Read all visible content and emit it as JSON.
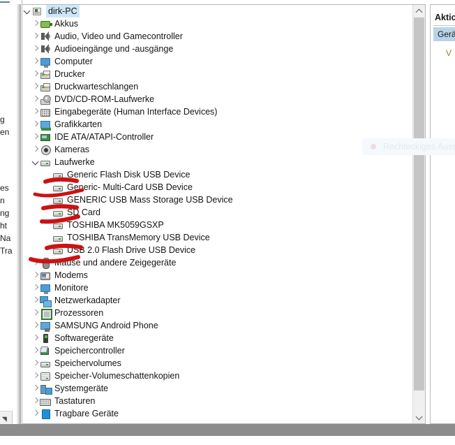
{
  "window": {
    "title_fragment": "Aktio",
    "bottom_bar_color": "#8c8c8c"
  },
  "left_background_window": {
    "text_fragments": [
      "g",
      "en",
      "es",
      "n",
      "ng",
      "ht",
      "Na",
      "Tra"
    ]
  },
  "tree": {
    "root": {
      "label": "dirk-PC",
      "icon": "computer-tower-icon",
      "expanded": true,
      "selected": true
    },
    "nodes": [
      {
        "label": "Akkus",
        "icon": "battery-icon",
        "level": 1,
        "expanded": false
      },
      {
        "label": "Audio, Video und Gamecontroller",
        "icon": "speaker-icon",
        "level": 1,
        "expanded": false
      },
      {
        "label": "Audioeingänge und -ausgänge",
        "icon": "speaker-icon",
        "level": 1,
        "expanded": false
      },
      {
        "label": "Computer",
        "icon": "monitor-icon",
        "level": 1,
        "expanded": false
      },
      {
        "label": "Drucker",
        "icon": "printer-icon",
        "level": 1,
        "expanded": false
      },
      {
        "label": "Druckwarteschlangen",
        "icon": "printer-icon",
        "level": 1,
        "expanded": false
      },
      {
        "label": "DVD/CD-ROM-Laufwerke",
        "icon": "dvd-drive-icon",
        "level": 1,
        "expanded": false
      },
      {
        "label": "Eingabegeräte (Human Interface Devices)",
        "icon": "hid-icon",
        "level": 1,
        "expanded": false
      },
      {
        "label": "Grafikkarten",
        "icon": "graphics-card-icon",
        "level": 1,
        "expanded": false
      },
      {
        "label": "IDE ATA/ATAPI-Controller",
        "icon": "ide-controller-icon",
        "level": 1,
        "expanded": false
      },
      {
        "label": "Kameras",
        "icon": "camera-icon",
        "level": 1,
        "expanded": false
      },
      {
        "label": "Laufwerke",
        "icon": "hard-drive-icon",
        "level": 1,
        "expanded": true
      },
      {
        "label": "Generic Flash Disk USB Device",
        "icon": "hard-drive-icon",
        "level": 2,
        "expanded": null,
        "marked": true
      },
      {
        "label": "Generic- Multi-Card USB Device",
        "icon": "hard-drive-icon",
        "level": 2,
        "expanded": null,
        "marked": true
      },
      {
        "label": "GENERIC USB Mass Storage USB Device",
        "icon": "hard-drive-icon",
        "level": 2,
        "expanded": null,
        "marked": true
      },
      {
        "label": "SD Card",
        "icon": "hard-drive-icon",
        "level": 2,
        "expanded": null,
        "marked": true
      },
      {
        "label": "TOSHIBA MK5059GSXP",
        "icon": "hard-drive-icon",
        "level": 2,
        "expanded": null,
        "marked": false
      },
      {
        "label": "TOSHIBA TransMemory USB Device",
        "icon": "hard-drive-icon",
        "level": 2,
        "expanded": null,
        "marked": true
      },
      {
        "label": "USB 2.0 Flash Drive USB Device",
        "icon": "hard-drive-icon",
        "level": 2,
        "expanded": null,
        "marked": true
      },
      {
        "label": "Mäuse und andere Zeigegeräte",
        "icon": "mouse-icon",
        "level": 1,
        "expanded": false
      },
      {
        "label": "Modems",
        "icon": "modem-icon",
        "level": 1,
        "expanded": false
      },
      {
        "label": "Monitore",
        "icon": "monitor-icon",
        "level": 1,
        "expanded": false
      },
      {
        "label": "Netzwerkadapter",
        "icon": "network-adapter-icon",
        "level": 1,
        "expanded": false
      },
      {
        "label": "Prozessoren",
        "icon": "cpu-icon",
        "level": 1,
        "expanded": false
      },
      {
        "label": "SAMSUNG Android Phone",
        "icon": "phone-icon",
        "level": 1,
        "expanded": false
      },
      {
        "label": "Softwaregeräte",
        "icon": "software-device-icon",
        "level": 1,
        "expanded": false
      },
      {
        "label": "Speichercontroller",
        "icon": "storage-controller-icon",
        "level": 1,
        "expanded": false
      },
      {
        "label": "Speichervolumes",
        "icon": "hard-drive-icon",
        "level": 1,
        "expanded": false
      },
      {
        "label": "Speicher-Volumeschattenkopien",
        "icon": "stacked-drive-icon",
        "level": 1,
        "expanded": false
      },
      {
        "label": "Systemgeräte",
        "icon": "system-devices-icon",
        "level": 1,
        "expanded": false
      },
      {
        "label": "Tastaturen",
        "icon": "keyboard-icon",
        "level": 1,
        "expanded": false
      },
      {
        "label": "Tragbare Geräte",
        "icon": "portable-device-icon",
        "level": 1,
        "expanded": false
      }
    ]
  },
  "annotations": {
    "color": "#cc1212",
    "description": "hand-drawn red strikethrough strokes over removable drive entries"
  },
  "actions_pane": {
    "title": "Aktio",
    "subtitle": "Gerät",
    "item": "V"
  },
  "snip_overlay": {
    "text": "Rechteckiges Auss"
  },
  "scrollbar": {
    "up_arrow": "chevron-up-icon",
    "down_arrow": "chevron-down-icon",
    "thumb": "scrollbar-thumb"
  }
}
